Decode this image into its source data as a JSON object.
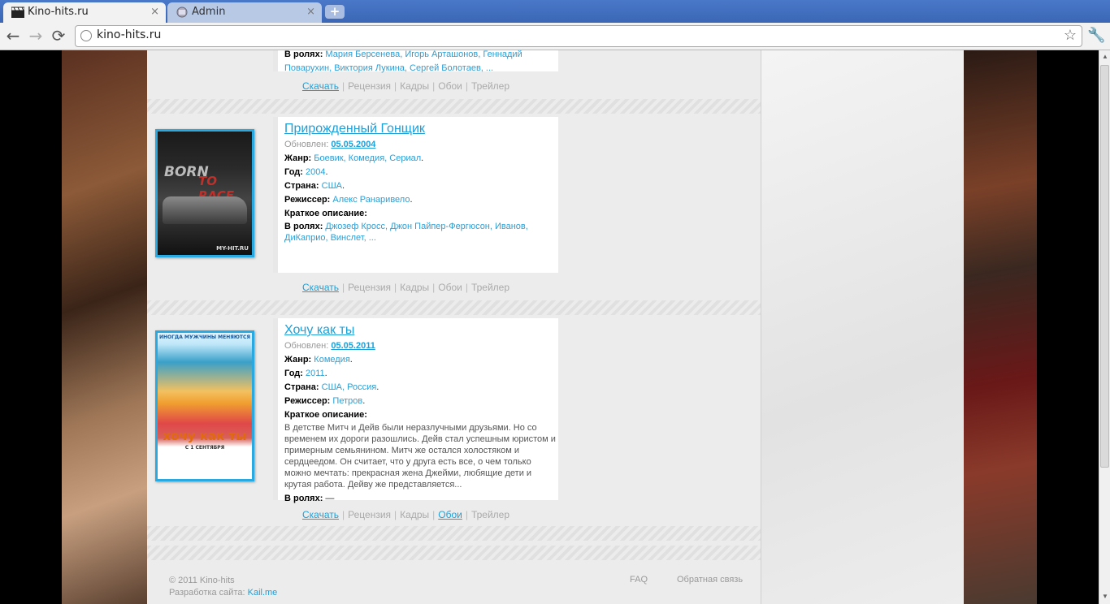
{
  "browser": {
    "tabs": [
      {
        "label": "Kino-hits.ru",
        "icon": "clapperboard-icon",
        "active": true
      },
      {
        "label": "Admin",
        "icon": "page-icon",
        "active": false
      }
    ],
    "close_glyph": "×",
    "new_tab_glyph": "+",
    "back_glyph": "←",
    "forward_glyph": "→",
    "reload_glyph": "⟳",
    "url": "kino-hits.ru",
    "star_glyph": "☆",
    "wrench_glyph": "🔧"
  },
  "movies": [
    {
      "cast_label": "В ролях:",
      "cast": "Мария Берсенева, Игорь Арташонов, Геннадий Поварухин, Виктория Лукина, Сергей Болотаев, ...",
      "links": {
        "download": "Скачать",
        "review": "Рецензия",
        "frames": "Кадры",
        "wallpapers": "Обои",
        "trailer": "Трейлер"
      }
    },
    {
      "title": "Прирожденный Гонщик",
      "updated_label": "Обновлен:",
      "updated": "05.05.2004",
      "genre_label": "Жанр:",
      "genre": "Боевик, Комедия, Сериал",
      "year_label": "Год:",
      "year": "2004",
      "country_label": "Страна:",
      "country": "США",
      "director_label": "Режиссер:",
      "director": "Алекс Ранаривело",
      "desc_label": "Краткое описание:",
      "cast_label": "В ролях:",
      "cast": "Джозеф Кросс, Джон Пайпер-Фергюсон, Иванов, ДиКаприо, Винслет, ...",
      "poster_text": "BORN",
      "poster_text2": "TO RACE",
      "poster_site": "MY-HIT.RU",
      "links": {
        "download": "Скачать",
        "review": "Рецензия",
        "frames": "Кадры",
        "wallpapers": "Обои",
        "trailer": "Трейлер"
      }
    },
    {
      "title": "Хочу как ты",
      "updated_label": "Обновлен:",
      "updated": "05.05.2011",
      "genre_label": "Жанр:",
      "genre": "Комедия",
      "year_label": "Год:",
      "year": "2011",
      "country_label": "Страна:",
      "country": "США, Россия",
      "director_label": "Режиссер:",
      "director": "Петров",
      "desc_label": "Краткое описание:",
      "description": "В детстве Митч и Дейв были неразлучными друзьями. Но со временем их дороги разошлись. Дейв стал успешным юристом и примерным семьянином. Митч же остался холостяком и сердцеедом. Он считает, что у друга есть все, о чем только можно мечтать: прекрасная жена Джейми, любящие дети и крутая работа. Дейву же представляется...",
      "cast_label": "В ролях:",
      "cast": "—",
      "poster_top": "ИНОГДА МУЖЧИНЫ МЕНЯЮТСЯ",
      "poster_title": "хочу как ты",
      "poster_date": "С 1 СЕНТЯБРЯ",
      "links": {
        "download": "Скачать",
        "review": "Рецензия",
        "frames": "Кадры",
        "wallpapers": "Обои",
        "trailer": "Трейлер"
      }
    }
  ],
  "footer": {
    "copyright": "© 2011 Kino-hits",
    "dev_label": "Разработка сайта:",
    "dev_link": "Kail.me",
    "faq": "FAQ",
    "feedback": "Обратная связь"
  },
  "colors": {
    "accent": "#1e9fd8",
    "tab_bar": "#4a78c8"
  }
}
